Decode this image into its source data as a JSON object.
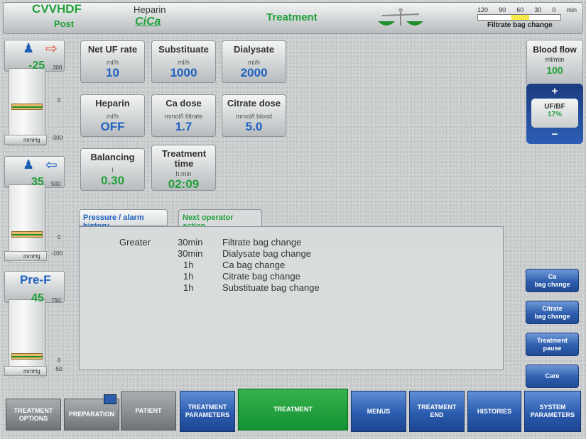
{
  "header": {
    "mode": "CVVHDF",
    "mode_sub": "Post",
    "anticoag_label": "Heparin",
    "anticoag_logo": "CiCa",
    "screen_title": "Treatment",
    "scale_icon": "balance-scale-icon",
    "bag_scale_ticks": [
      "120",
      "90",
      "60",
      "30",
      "0",
      "min"
    ],
    "bag_scale_level": 0.5,
    "bag_scale_label": "Filtrate bag change"
  },
  "gauges": [
    {
      "name": "arterial",
      "icon": "person-icon",
      "arrow": "arrow-out-icon",
      "value": "-25",
      "top_tick": "300",
      "mid_tick": "0",
      "bottom_tick": "-300",
      "unit": "mmHg",
      "color": "#22a03a",
      "arrow_color": "#e04a2a"
    },
    {
      "name": "venous",
      "icon": "person-icon",
      "arrow": "arrow-in-icon",
      "value": "35",
      "top_tick": "500",
      "mid_tick": "0",
      "bottom_tick": "-100",
      "unit": "mmHg",
      "color": "#22a03a",
      "arrow_color": "#1e62c0"
    },
    {
      "name": "prefilter",
      "label": "Pre-F",
      "value": "45",
      "top_tick": "750",
      "mid_tick": "0",
      "bottom_tick": "-50",
      "unit": "mmHg",
      "color": "#22a03a"
    }
  ],
  "tiles": [
    {
      "label": "Net UF rate",
      "unit": "ml/h",
      "value": "10",
      "color": "blue"
    },
    {
      "label": "Substituate",
      "unit": "ml/h",
      "value": "1000",
      "color": "blue"
    },
    {
      "label": "Dialysate",
      "unit": "ml/h",
      "value": "2000",
      "color": "blue"
    },
    {
      "label": "Heparin",
      "unit": "ml/h",
      "value": "OFF",
      "color": "blue"
    },
    {
      "label": "Ca dose",
      "unit": "mmol/l filtrate",
      "value": "1.7",
      "color": "blue"
    },
    {
      "label": "Citrate dose",
      "unit": "mmol/l blood",
      "value": "5.0",
      "color": "blue"
    },
    {
      "label": "Balancing",
      "unit": "l",
      "value": "0.30",
      "color": "green"
    },
    {
      "label": "Treatment time",
      "unit": "h:min",
      "value": "02:09",
      "color": "green"
    }
  ],
  "tabs": {
    "history": "Pressure / alarm history",
    "next": "Next operator action"
  },
  "next_actions": [
    {
      "prefix": "Greater",
      "time": "30min",
      "action": "Filtrate bag change"
    },
    {
      "prefix": "",
      "time": "30min",
      "action": "Dialysate bag change"
    },
    {
      "prefix": "",
      "time": "1h",
      "action": "Ca bag change"
    },
    {
      "prefix": "",
      "time": "1h",
      "action": "Citrate bag change"
    },
    {
      "prefix": "",
      "time": "1h",
      "action": "Substituate bag change"
    }
  ],
  "blood_flow": {
    "label": "Blood flow",
    "unit": "ml/min",
    "value": "100",
    "plus": "+",
    "minus": "−",
    "ratio_label": "UF/BF",
    "ratio_value": "17%"
  },
  "right_buttons": [
    {
      "line1": "Ca",
      "line2": "bag change"
    },
    {
      "line1": "Citrate",
      "line2": "bag change"
    },
    {
      "line1": "Treatment",
      "line2": "pause"
    },
    {
      "line1": "Care",
      "line2": ""
    }
  ],
  "nav": [
    {
      "line1": "TREATMENT",
      "line2": "OPTIONS",
      "style": "grey"
    },
    {
      "line1": "PREPARATION",
      "line2": "",
      "style": "grey"
    },
    {
      "line1": "PATIENT",
      "line2": "",
      "style": "grey"
    },
    {
      "line1": "TREATMENT",
      "line2": "PARAMETERS",
      "style": "blue"
    },
    {
      "line1": "TREATMENT",
      "line2": "",
      "style": "green"
    },
    {
      "line1": "MENUS",
      "line2": "",
      "style": "blue"
    },
    {
      "line1": "TREATMENT",
      "line2": "END",
      "style": "blue"
    },
    {
      "line1": "HISTORIES",
      "line2": "",
      "style": "blue"
    },
    {
      "line1": "SYSTEM",
      "line2": "PARAMETERS",
      "style": "blue"
    }
  ]
}
